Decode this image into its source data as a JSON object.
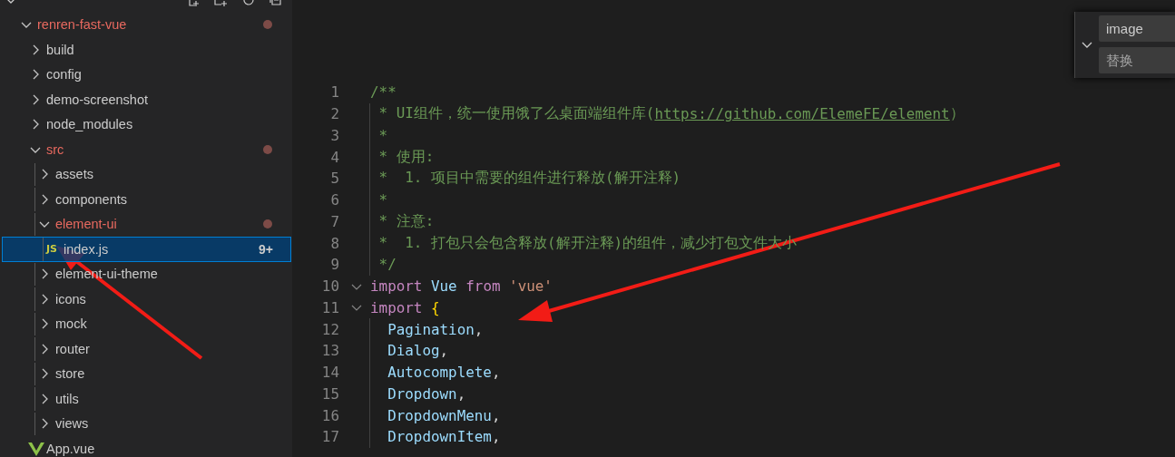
{
  "explorer": {
    "expanded": true,
    "items": [
      {
        "label": "renren-fast-vue",
        "kind": "folder",
        "expanded": true,
        "modified": true,
        "selected": false,
        "children": [
          {
            "label": "build",
            "kind": "folder",
            "expanded": false,
            "modified": false,
            "selected": false
          },
          {
            "label": "config",
            "kind": "folder",
            "expanded": false,
            "modified": false,
            "selected": false
          },
          {
            "label": "demo-screenshot",
            "kind": "folder",
            "expanded": false,
            "modified": false,
            "selected": false
          },
          {
            "label": "node_modules",
            "kind": "folder",
            "expanded": false,
            "modified": false,
            "selected": false
          },
          {
            "label": "src",
            "kind": "folder",
            "expanded": true,
            "modified": true,
            "selected": false,
            "children": [
              {
                "label": "assets",
                "kind": "folder",
                "expanded": false,
                "modified": false,
                "selected": false
              },
              {
                "label": "components",
                "kind": "folder",
                "expanded": false,
                "modified": false,
                "selected": false
              },
              {
                "label": "element-ui",
                "kind": "folder",
                "expanded": true,
                "modified": true,
                "selected": false,
                "children": [
                  {
                    "label": "index.js",
                    "kind": "js",
                    "icon_label": "JS",
                    "badge": "9+",
                    "modified": false,
                    "selected": true
                  }
                ]
              },
              {
                "label": "element-ui-theme",
                "kind": "folder",
                "expanded": false,
                "modified": false,
                "selected": false
              },
              {
                "label": "icons",
                "kind": "folder",
                "expanded": false,
                "modified": false,
                "selected": false
              },
              {
                "label": "mock",
                "kind": "folder",
                "expanded": false,
                "modified": false,
                "selected": false
              },
              {
                "label": "router",
                "kind": "folder",
                "expanded": false,
                "modified": false,
                "selected": false
              },
              {
                "label": "store",
                "kind": "folder",
                "expanded": false,
                "modified": false,
                "selected": false
              },
              {
                "label": "utils",
                "kind": "folder",
                "expanded": false,
                "modified": false,
                "selected": false
              },
              {
                "label": "views",
                "kind": "folder",
                "expanded": false,
                "modified": false,
                "selected": false
              }
            ]
          },
          {
            "label": "App.vue",
            "kind": "vue",
            "modified": false,
            "selected": false
          }
        ]
      }
    ]
  },
  "code": [
    {
      "number": "1",
      "tokens": [
        {
          "text": "/**",
          "kind": "comment"
        }
      ]
    },
    {
      "number": "2",
      "tokens": [
        {
          "text": " * UI组件，统一使用饿了么桌面端组件库(",
          "kind": "comment"
        },
        {
          "text": "https://github.com/ElemeFE/element",
          "kind": "link"
        },
        {
          "text": "）",
          "kind": "comment"
        }
      ]
    },
    {
      "number": "3",
      "tokens": [
        {
          "text": " *",
          "kind": "comment"
        }
      ]
    },
    {
      "number": "4",
      "tokens": [
        {
          "text": " * 使用:",
          "kind": "comment"
        }
      ]
    },
    {
      "number": "5",
      "tokens": [
        {
          "text": " *  1. 项目中需要的组件进行释放(解开注释)",
          "kind": "comment"
        }
      ]
    },
    {
      "number": "6",
      "tokens": [
        {
          "text": " *",
          "kind": "comment"
        }
      ]
    },
    {
      "number": "7",
      "tokens": [
        {
          "text": " * 注意:",
          "kind": "comment"
        }
      ]
    },
    {
      "number": "8",
      "tokens": [
        {
          "text": " *  1. 打包只会包含释放(解开注释)的组件，减少打包文件大小",
          "kind": "comment"
        }
      ]
    },
    {
      "number": "9",
      "tokens": [
        {
          "text": " */",
          "kind": "comment"
        }
      ]
    },
    {
      "number": "10",
      "fold": true,
      "tokens": [
        {
          "text": "import",
          "kind": "keyword"
        },
        {
          "text": " Vue",
          "kind": "ident"
        },
        {
          "text": " from",
          "kind": "keyword"
        },
        {
          "text": " 'vue'",
          "kind": "string"
        }
      ]
    },
    {
      "number": "11",
      "fold": true,
      "tokens": [
        {
          "text": "import",
          "kind": "keyword"
        },
        {
          "text": " {",
          "kind": "brace"
        }
      ]
    },
    {
      "number": "12",
      "tokens": [
        {
          "text": "  Pagination",
          "kind": "ident"
        },
        {
          "text": ",",
          "kind": "plain"
        }
      ]
    },
    {
      "number": "13",
      "tokens": [
        {
          "text": "  Dialog",
          "kind": "ident"
        },
        {
          "text": ",",
          "kind": "plain"
        }
      ]
    },
    {
      "number": "14",
      "tokens": [
        {
          "text": "  Autocomplete",
          "kind": "ident"
        },
        {
          "text": ",",
          "kind": "plain"
        }
      ]
    },
    {
      "number": "15",
      "tokens": [
        {
          "text": "  Dropdown",
          "kind": "ident"
        },
        {
          "text": ",",
          "kind": "plain"
        }
      ]
    },
    {
      "number": "16",
      "tokens": [
        {
          "text": "  DropdownMenu",
          "kind": "ident"
        },
        {
          "text": ",",
          "kind": "plain"
        }
      ]
    },
    {
      "number": "17",
      "tokens": [
        {
          "text": "  DropdownItem",
          "kind": "ident"
        },
        {
          "text": ",",
          "kind": "plain"
        }
      ]
    }
  ],
  "find_widget": {
    "replace_expanded": true,
    "find_value": "image",
    "replace_placeholder": "替换"
  }
}
